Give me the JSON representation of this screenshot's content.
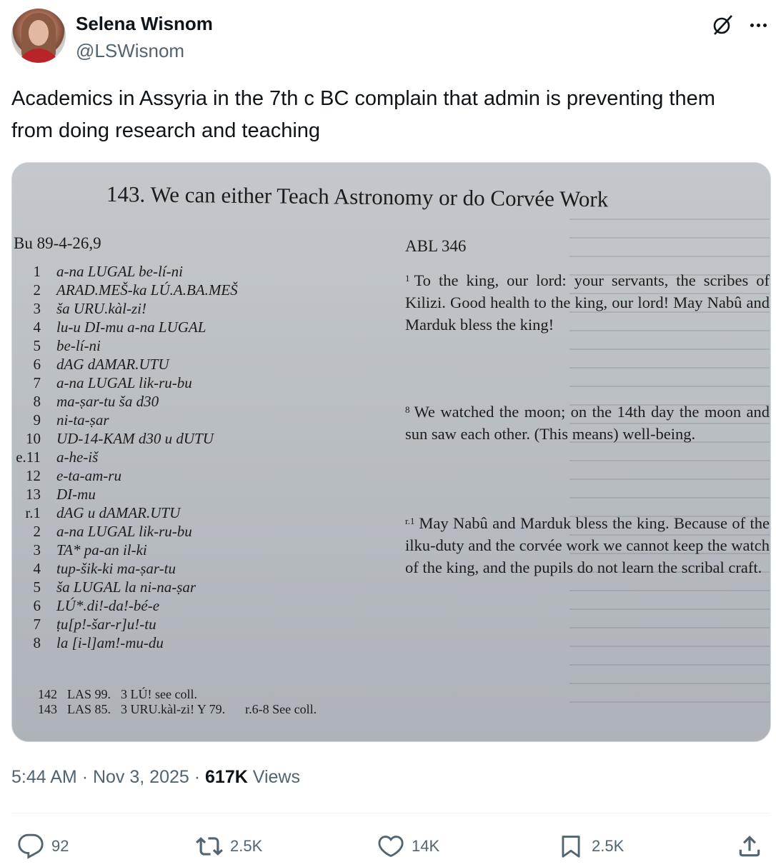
{
  "author": {
    "name": "Selena Wisnom",
    "handle": "@LSWisnom",
    "avatar_icon": "profile-photo"
  },
  "header_icons": [
    "grok-icon",
    "more-icon"
  ],
  "tweet": {
    "text": "Academics in Assyria in the 7th c BC complain that admin is preventing them from doing research and teaching"
  },
  "photo": {
    "title": "143. We can either Teach Astronomy or do Corvée Work",
    "left_heading": "Bu 89-4-26,9",
    "right_heading": "ABL 346",
    "lines": [
      {
        "n": "1",
        "t": "a-na LUGAL be-lí-ni"
      },
      {
        "n": "2",
        "t": "ARAD.MEŠ-ka LÚ.A.BA.MEŠ"
      },
      {
        "n": "3",
        "t": "ša URU.kàl-zi!"
      },
      {
        "n": "4",
        "t": "lu-u DI-mu a-na LUGAL"
      },
      {
        "n": "5",
        "t": "be-lí-ni"
      },
      {
        "n": "6",
        "t": "dAG dAMAR.UTU"
      },
      {
        "n": "7",
        "t": "a-na LUGAL lik-ru-bu"
      },
      {
        "n": "8",
        "t": "ma-ṣar-tu ša d30"
      },
      {
        "n": "9",
        "t": "ni-ta-ṣar"
      },
      {
        "n": "10",
        "t": "UD-14-KAM d30 u dUTU"
      },
      {
        "n": "e.11",
        "t": "a-he-iš"
      },
      {
        "n": "12",
        "t": "e-ta-am-ru"
      },
      {
        "n": "13",
        "t": "DI-mu"
      },
      {
        "n": "r.1",
        "t": "dAG u dAMAR.UTU"
      },
      {
        "n": "2",
        "t": "a-na LUGAL lik-ru-bu"
      },
      {
        "n": "3",
        "t": "TA* pa-an il-ki"
      },
      {
        "n": "4",
        "t": "tup-šik-ki ma-ṣar-tu"
      },
      {
        "n": "5",
        "t": "ša LUGAL la ni-na-ṣar"
      },
      {
        "n": "6",
        "t": "LÚ*.di!-da!-bé-e"
      },
      {
        "n": "7",
        "t": "ṭu[p!-šar-r]u!-tu"
      },
      {
        "n": "8",
        "t": "la [i-l]am!-mu-du"
      }
    ],
    "translation": [
      {
        "sn": "1",
        "t": "To the king, our lord: your servants, the scribes of Kilizi. Good health to the king, our lord! May Nabû and Marduk bless the king!"
      },
      {
        "sn": "8",
        "t": "We watched the moon; on the 14th day the moon and sun saw each other. (This means) well-being."
      },
      {
        "sn": "r.1",
        "t": "May Nabû and Marduk bless the king. Because of the ilku-duty and the corvée work we cannot keep the watch of the king, and the pupils do not learn the scribal craft."
      }
    ],
    "footnotes": [
      {
        "num": "142",
        "src": "LAS 99.",
        "note": "3 LÚ! see coll.",
        "extra": ""
      },
      {
        "num": "143",
        "src": "LAS 85.",
        "note": "3 URU.kàl-zi! Y 79.",
        "extra": "r.6-8 See coll."
      }
    ]
  },
  "meta": {
    "time": "5:44 AM",
    "sep1": "·",
    "date": "Nov 3, 2025",
    "sep2": "·",
    "views_count": "617K",
    "views_label": "Views"
  },
  "actions": {
    "replies": "92",
    "reposts": "2.5K",
    "likes": "14K",
    "bookmarks": "2.5K"
  }
}
